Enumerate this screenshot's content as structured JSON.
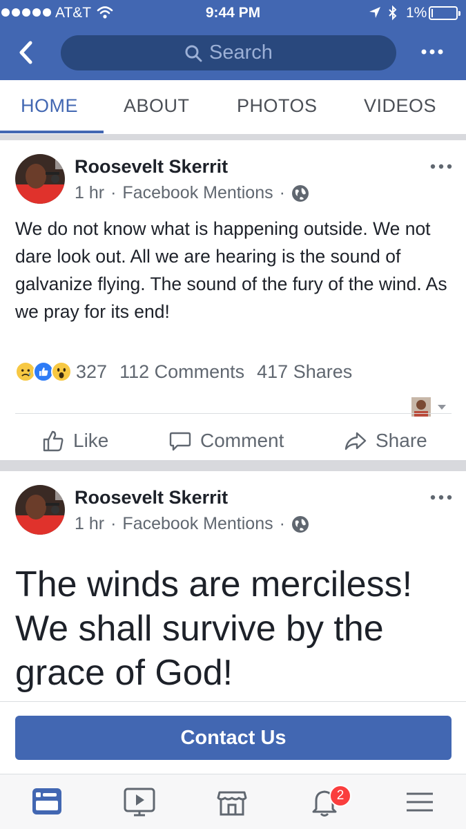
{
  "status_bar": {
    "carrier": "AT&T",
    "time": "9:44 PM",
    "battery_percent": "1%",
    "battery_level": 0.01,
    "icons": [
      "signal-dots-icon",
      "wifi-icon",
      "location-arrow-icon",
      "bluetooth-icon",
      "battery-icon"
    ]
  },
  "nav": {
    "search_placeholder": "Search",
    "icons": [
      "back-chevron-icon",
      "search-icon",
      "more-dots-icon"
    ]
  },
  "tabs": [
    {
      "label": "HOME",
      "active": true
    },
    {
      "label": "ABOUT",
      "active": false
    },
    {
      "label": "PHOTOS",
      "active": false
    },
    {
      "label": "VIDEOS",
      "active": false
    }
  ],
  "posts": [
    {
      "author": "Roosevelt Skerrit",
      "time": "1 hr",
      "source": "Facebook Mentions",
      "privacy_icon": "globe-icon",
      "text": "We do not know what is happening outside. We not dare look out. All we are hearing is the sound of galvanize flying. The sound of the fury of the wind. As we pray for its end!",
      "reactions": {
        "icons": [
          "sad-reaction-icon",
          "like-reaction-icon",
          "wow-reaction-icon"
        ],
        "count": "327",
        "comments": "112 Comments",
        "shares": "417 Shares"
      },
      "actions": {
        "like": "Like",
        "comment": "Comment",
        "share": "Share"
      }
    },
    {
      "author": "Roosevelt Skerrit",
      "time": "1 hr",
      "source": "Facebook Mentions",
      "privacy_icon": "globe-icon",
      "text": "The winds are merciless! We shall survive by the grace of God!"
    }
  ],
  "contact_button": "Contact Us",
  "bottom_nav": {
    "items": [
      "news-feed-icon",
      "video-icon",
      "marketplace-icon",
      "notifications-bell-icon",
      "menu-icon"
    ],
    "notification_badge": "2"
  },
  "colors": {
    "brand_blue": "#4267b2",
    "search_bg": "#29487d",
    "badge_red": "#fa3e3e"
  }
}
